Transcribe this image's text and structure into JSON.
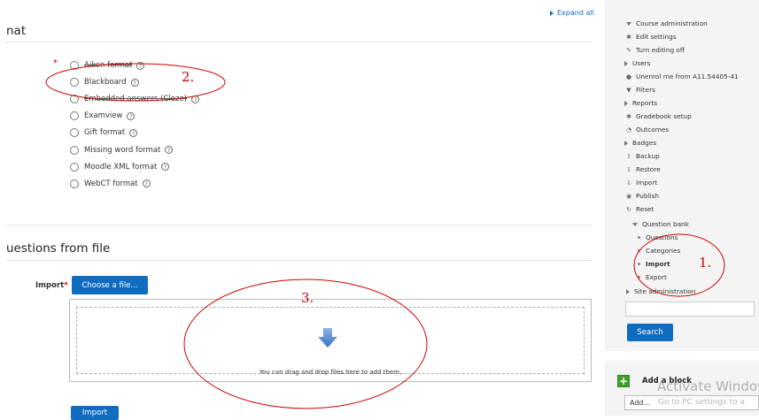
{
  "expand_all": "Expand all",
  "format_section": {
    "title": "nat"
  },
  "formats": [
    {
      "label": "Aiken format",
      "strike": true
    },
    {
      "label": "Blackboard",
      "strike": false
    },
    {
      "label": "Embedded answers (Cloze)",
      "strike": true
    },
    {
      "label": "Examview",
      "strike": false
    },
    {
      "label": "Gift format",
      "strike": false
    },
    {
      "label": "Missing word format",
      "strike": false
    },
    {
      "label": "Moodle XML format",
      "strike": false
    },
    {
      "label": "WebCT format",
      "strike": false
    }
  ],
  "required_mark": "*",
  "help_glyph": "?",
  "import_section": {
    "title": "uestions from file",
    "field_label": "Import",
    "choose_file_button": "Choose a file...",
    "drop_hint": "You can drag and drop files here to add them.",
    "submit_button": "Import"
  },
  "annotations": {
    "one": "1.",
    "two": "2.",
    "three": "3.",
    "color": "#cc0000"
  },
  "sidebar": {
    "items": [
      {
        "label": "Course administration",
        "icon": "chevron-down-icon",
        "glyph": ""
      },
      {
        "label": "Edit settings",
        "icon": "gear-icon",
        "glyph": "✱"
      },
      {
        "label": "Turn editing off",
        "icon": "pencil-icon",
        "glyph": "✎"
      },
      {
        "label": "Users",
        "icon": "chevron-right-icon",
        "glyph": ""
      },
      {
        "label": "Unenrol me from A11.54405-41",
        "icon": "user-icon",
        "glyph": "●"
      },
      {
        "label": "Filters",
        "icon": "filter-icon",
        "glyph": "▼"
      },
      {
        "label": "Reports",
        "icon": "chevron-right-icon",
        "glyph": ""
      },
      {
        "label": "Gradebook setup",
        "icon": "gear-icon",
        "glyph": "✱"
      },
      {
        "label": "Outcomes",
        "icon": "outcomes-icon",
        "glyph": "◔"
      },
      {
        "label": "Badges",
        "icon": "chevron-right-icon",
        "glyph": ""
      },
      {
        "label": "Backup",
        "icon": "upload-icon",
        "glyph": "⇧"
      },
      {
        "label": "Restore",
        "icon": "download-icon",
        "glyph": "⇩"
      },
      {
        "label": "Import",
        "icon": "download-icon",
        "glyph": "⇩"
      },
      {
        "label": "Publish",
        "icon": "globe-icon",
        "glyph": "◉"
      },
      {
        "label": "Reset",
        "icon": "reset-icon",
        "glyph": "↻"
      },
      {
        "label": "Question bank",
        "icon": "chevron-down-icon",
        "glyph": ""
      },
      {
        "label": "Questions",
        "icon": "bullet-icon",
        "glyph": ""
      },
      {
        "label": "Categories",
        "icon": "bullet-icon",
        "glyph": ""
      },
      {
        "label": "Import",
        "icon": "bullet-icon",
        "glyph": ""
      },
      {
        "label": "Export",
        "icon": "bullet-icon",
        "glyph": ""
      },
      {
        "label": "Site administration",
        "icon": "chevron-right-icon",
        "glyph": ""
      }
    ],
    "search_button": "Search",
    "search_value": "",
    "add_block": {
      "title": "Add a block",
      "select_value": "Add..."
    }
  },
  "watermark": {
    "line1": "Activate Window",
    "line2": "Go to PC settings to a"
  },
  "colors": {
    "brand_blue": "#0f6cbf",
    "required_red": "#cc0000",
    "add_green": "#3fa02c",
    "panel_bg": "#f4f4f4"
  }
}
